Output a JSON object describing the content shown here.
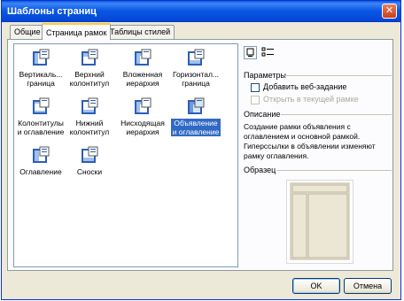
{
  "window": {
    "title": "Шаблоны страниц",
    "close": "✕"
  },
  "tabs": [
    {
      "label": "Общие"
    },
    {
      "label": "Страница рамок"
    },
    {
      "label": "Таблицы стилей"
    }
  ],
  "templates": [
    {
      "label": "Вертикаль... граница",
      "icon": "vertical-border-frame-icon"
    },
    {
      "label": "Верхний колонтитул",
      "icon": "header-frame-icon"
    },
    {
      "label": "Вложенная иерархия",
      "icon": "nested-hierarchy-frame-icon"
    },
    {
      "label": "Горизонтал... граница",
      "icon": "horizontal-border-frame-icon"
    },
    {
      "label": "Колонтитулы и оглавление",
      "icon": "header-footer-toc-frame-icon"
    },
    {
      "label": "Нижний колонтитул",
      "icon": "footer-frame-icon"
    },
    {
      "label": "Нисходящая иерархия",
      "icon": "top-down-hierarchy-frame-icon"
    },
    {
      "label": "Объявление и оглавление",
      "icon": "banner-toc-frame-icon",
      "selected": true
    },
    {
      "label": "Оглавление",
      "icon": "toc-frame-icon"
    },
    {
      "label": "Сноски",
      "icon": "footnotes-frame-icon"
    }
  ],
  "options": {
    "heading": "Параметры",
    "add_web_task": "Добавить веб-задание",
    "open_in_current_frame": "Открыть в текущей рамке"
  },
  "description": {
    "heading": "Описание",
    "text": "Создание рамки объявления с оглавлением и основной рамкой. Гиперссылки в объявлении изменяют рамку оглавления."
  },
  "preview": {
    "heading": "Образец"
  },
  "buttons": {
    "ok": "OK",
    "cancel": "Отмена"
  },
  "colors": {
    "title_bar": "#0a58e4",
    "selection": "#316ac5",
    "dialog_bg": "#ece9d8"
  }
}
